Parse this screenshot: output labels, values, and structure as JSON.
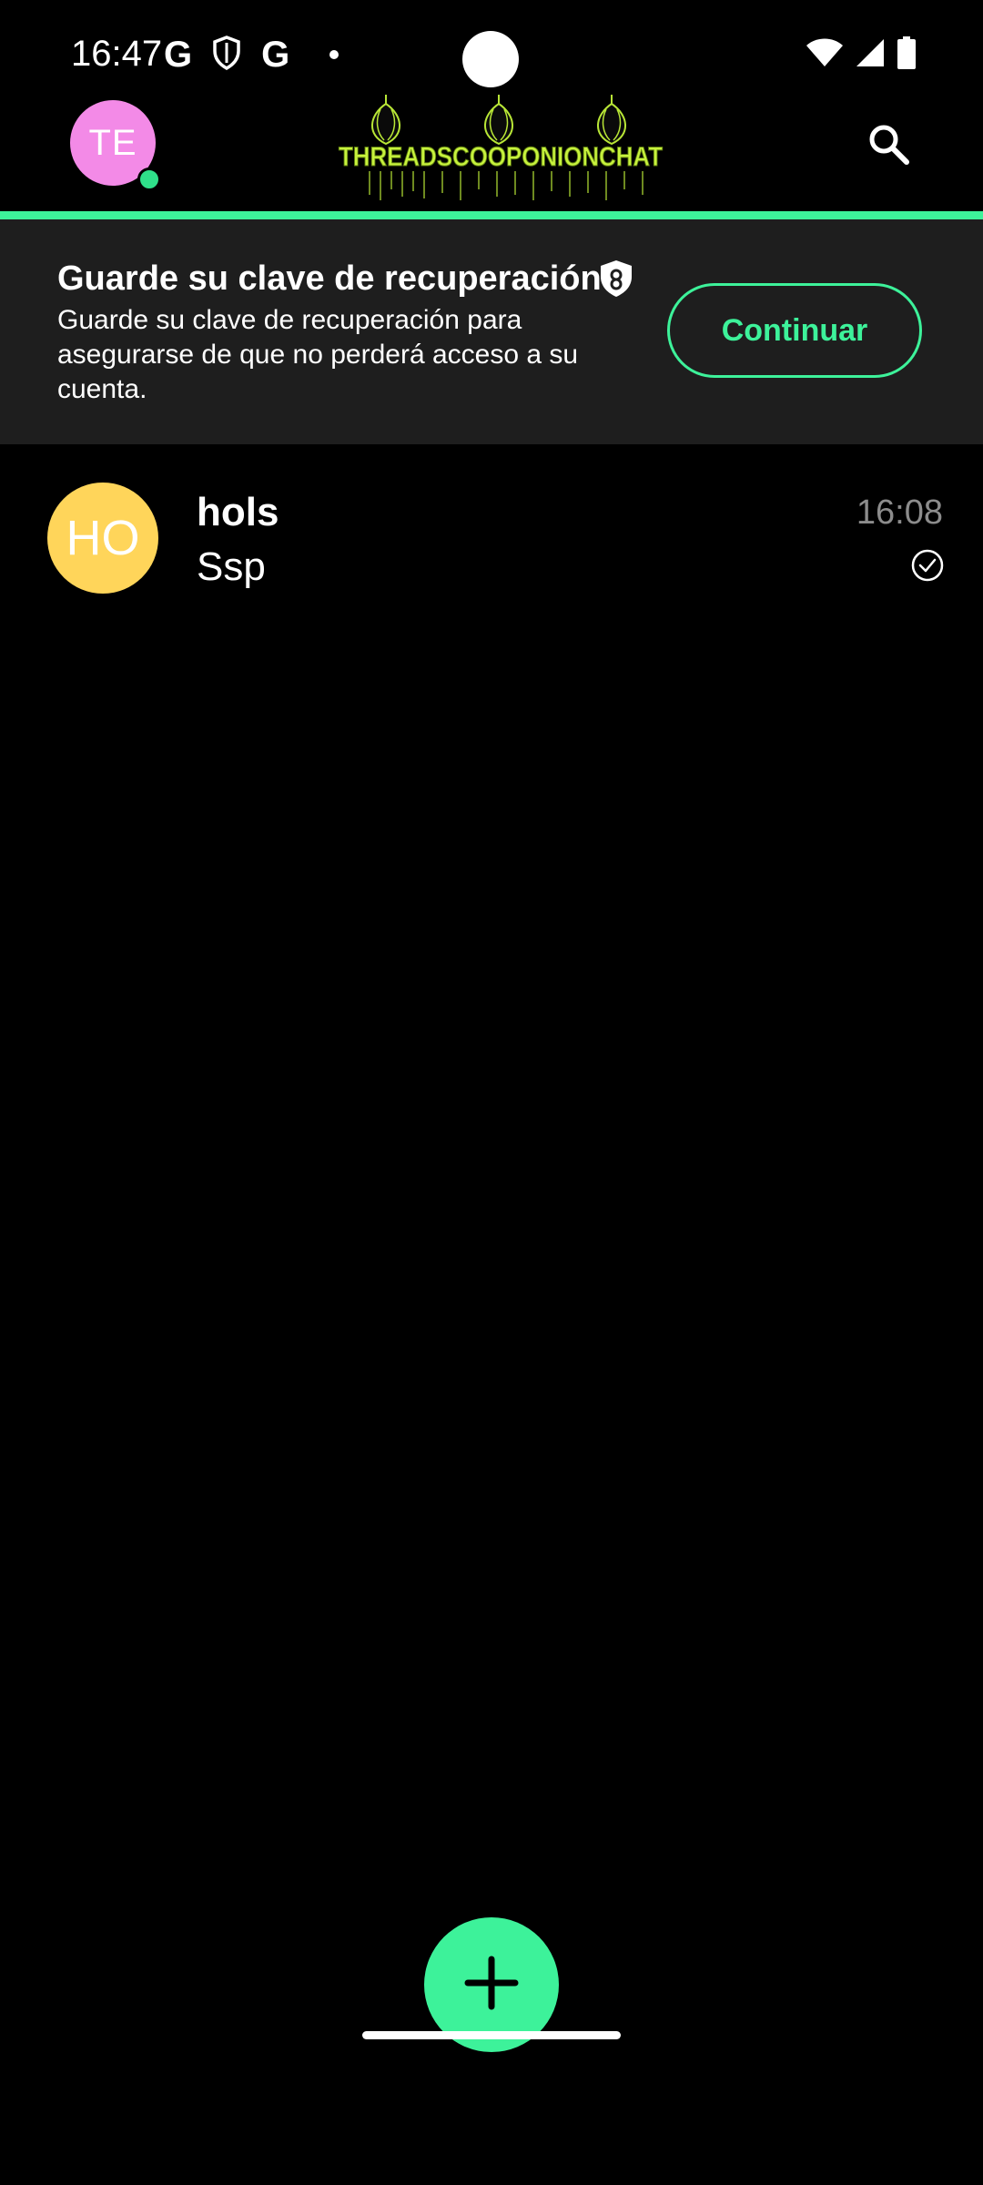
{
  "status_bar": {
    "time": "16:47",
    "left_icons": [
      "google-g-icon",
      "shield-icon",
      "google-g-icon",
      "dot-icon"
    ],
    "right_icons": [
      "wifi-icon",
      "cellular-signal-icon",
      "battery-icon"
    ],
    "g_glyph": "G"
  },
  "app_bar": {
    "avatar_initials": "TE",
    "avatar_color": "#f38ae7",
    "online_color": "#2fe08a",
    "logo_text": "THREADSCOOPONIONCHAT",
    "search_icon": "search-icon"
  },
  "banner": {
    "title": "Guarde su clave de recuperación",
    "body": "Guarde su clave de recuperación para asegurarse de que no perderá acceso a su cuenta.",
    "button_label": "Continuar",
    "accent_color": "#3df29a"
  },
  "conversations": [
    {
      "initials": "HO",
      "name": "hols",
      "preview": "Ssp",
      "time": "16:08",
      "avatar_color": "#ffd55a",
      "status_icon": "check-circle-icon"
    }
  ],
  "fab": {
    "icon": "plus-icon",
    "color": "#3df29a"
  }
}
